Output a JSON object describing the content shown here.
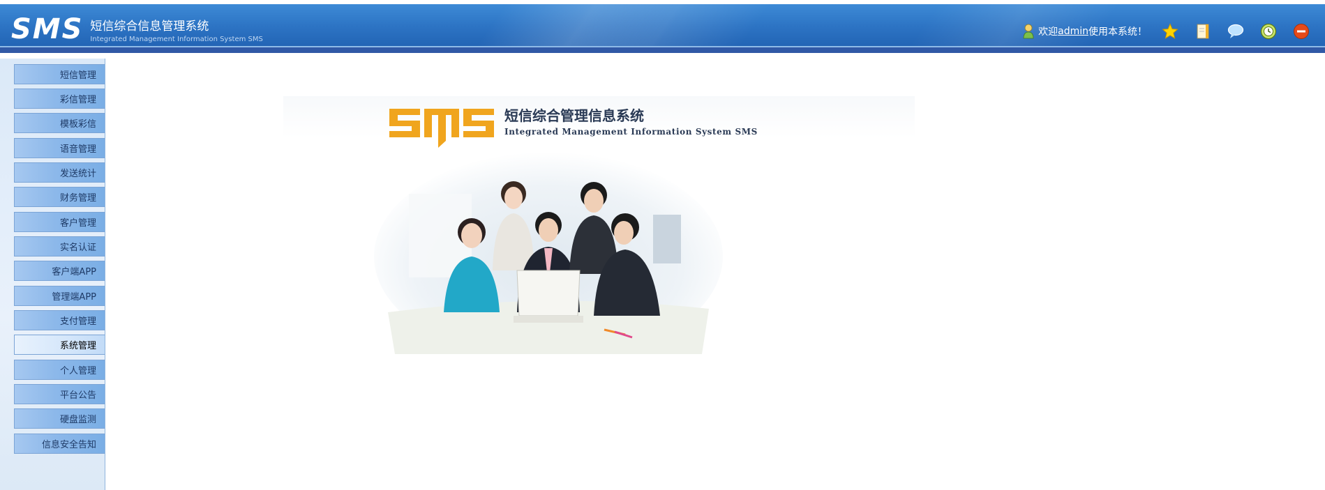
{
  "header": {
    "logo_mark": "SMS",
    "title_cn": "短信综合信息管理系统",
    "title_en": "Integrated Management Information System SMS",
    "welcome_prefix": "欢迎",
    "username": "admin",
    "welcome_suffix": "使用本系统！",
    "toolbar_icons": [
      "star-icon",
      "notebook-icon",
      "chat-icon",
      "clock-icon",
      "exit-icon"
    ]
  },
  "sidebar": {
    "items": [
      {
        "label": "短信管理"
      },
      {
        "label": "彩信管理"
      },
      {
        "label": "模板彩信"
      },
      {
        "label": "语音管理"
      },
      {
        "label": "发送统计"
      },
      {
        "label": "财务管理"
      },
      {
        "label": "客户管理"
      },
      {
        "label": "实名认证"
      },
      {
        "label": "客户端APP"
      },
      {
        "label": "管理端APP"
      },
      {
        "label": "支付管理"
      },
      {
        "label": "系统管理",
        "active": true
      },
      {
        "label": "个人管理"
      },
      {
        "label": "平台公告"
      },
      {
        "label": "硬盘监测"
      },
      {
        "label": "信息安全告知"
      }
    ]
  },
  "main": {
    "brand_mark": "SMS",
    "brand_cn": "短信综合管理信息系统",
    "brand_en": "Integrated Management Information System SMS",
    "photo": "office-team-photo"
  },
  "colors": {
    "header": "#2d74c4",
    "brand_orange": "#f0a51e",
    "menu": "#8cb8ea"
  }
}
